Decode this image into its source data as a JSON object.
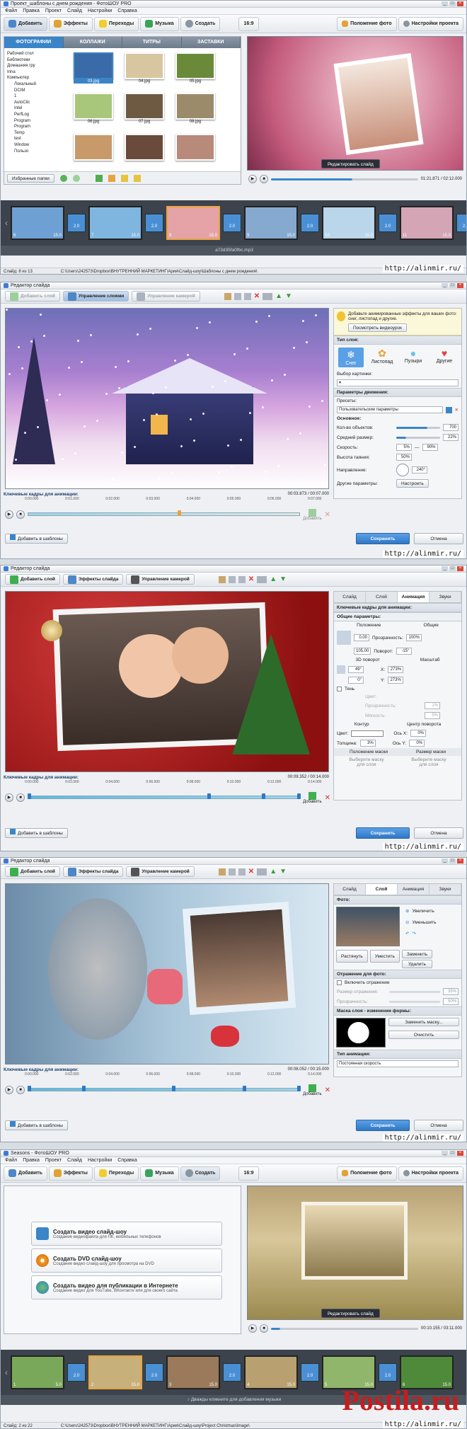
{
  "s1": {
    "title": "Проект_шаблоны с днем рождения - ФотоШОУ PRO",
    "menu": [
      "Файл",
      "Правка",
      "Проект",
      "Слайд",
      "Настройки",
      "Справка"
    ],
    "tabs": [
      "Добавить",
      "Эффекты",
      "Переходы",
      "Музыка",
      "Создать"
    ],
    "ratio": "16:9",
    "photo_pos": "Положение фото",
    "proj_settings": "Настройки проекта",
    "subtabs": [
      "ФОТОГРАФИИ",
      "КОЛЛАЖИ",
      "ТИТРЫ",
      "ЗАСТАВКИ"
    ],
    "tree": [
      "Рабочий стол",
      "Библиотеки",
      "Домашняя гру",
      "Irina",
      "Компьютер",
      "Локальный",
      "DCIM",
      "1",
      "AutoClic",
      "Intel",
      "PerfLog",
      "Program",
      "Program",
      "Temp",
      "test",
      "Window",
      "Пользо"
    ],
    "files": [
      "03.jpg",
      "04.jpg",
      "05.jpg",
      "06.jpg",
      "07.jpg",
      "08.jpg",
      "",
      "",
      ""
    ],
    "fav": "Избранные папки",
    "edit_slide": "Редактировать слайд",
    "time": "01:21.871 / 02:12.000",
    "slides": [
      {
        "n": "6",
        "d": "15.0"
      },
      {
        "n": "7",
        "d": "15.0"
      },
      {
        "n": "8",
        "d": "15.0"
      },
      {
        "n": "9",
        "d": "15.0"
      },
      {
        "n": "10",
        "d": "15.0"
      },
      {
        "n": "11",
        "d": "15.0"
      }
    ],
    "trans": [
      "2.0",
      "2.0",
      "2.0",
      "2.0",
      "2.0",
      "2.0"
    ],
    "audio": "a73d35fa0fbc.mp3",
    "status_left": "Слайд: 8 из 13",
    "status_path": "C:\\Users\\242573\\Dropbox\\ВНУТРЕННИЙ МАРКЕТИНГ\\Ария\\Слайд-шоу\\Шаблоны с днем рождения\\",
    "watermark": "http://alinmir.ru/"
  },
  "s2": {
    "title": "Редактор слайда",
    "tools": [
      "Добавить слой",
      "Управление слоями",
      "Управление камерой"
    ],
    "tip": "Добавьте анимированные эффекты для ваших фото: снег, листопад и другие.",
    "tip_btn": "Посмотреть видеоурок",
    "layer_type": "Тип слоя:",
    "types": [
      "Снег",
      "Листопад",
      "Пузыри",
      "Другие"
    ],
    "pick": "Выбор картинки:",
    "motion": "Параметры движения:",
    "presets": "Пресеты:",
    "preset_val": "Пользовательские параметры",
    "basic": "Основное:",
    "count_l": "Кол-во объектов:",
    "count_v": "700",
    "size_l": "Средний размер:",
    "size_v": "22%",
    "speed_l": "Скорость:",
    "speed_a": "5%",
    "speed_b": "90%",
    "fade_l": "Высота таяния:",
    "fade_v": "50%",
    "dir_l": "Направление:",
    "dir_v": "240°",
    "other_l": "Другие параметры:",
    "other_btn": "Настроить",
    "kf": "Ключевые кадры для анимации:",
    "kf_time": "00:03.873 / 00:07.000",
    "ruler": [
      "0:00.000",
      "0:01.000",
      "0:02.000",
      "0:03.000",
      "0:04.000",
      "0:05.000",
      "0:06.000",
      "0:07.000"
    ],
    "add": "Добавить",
    "tmpl": "Добавить в шаблоны",
    "save": "Сохранить",
    "cancel": "Отмена",
    "watermark": "http://alinmir.ru/"
  },
  "s3": {
    "title": "Редактор слайда",
    "tools": [
      "Добавить слой",
      "Эффекты слайда",
      "Управление камерой"
    ],
    "rtabs": [
      "Слайд",
      "Слой",
      "Анимация",
      "Звуки"
    ],
    "kf_title": "Ключевые кадры для анимации:",
    "common": "Общие параметры:",
    "pos": "Положение",
    "gen": "Общие",
    "x": "0,00",
    "y": "105,00",
    "opacity_l": "Прозрачность:",
    "opacity_v": "100%",
    "rot_l": "Поворот:",
    "rot_v": "-15°",
    "r3d": "3D поворот",
    "scale": "Масштаб",
    "r3a": "49°",
    "r3b": "0°",
    "sx": "273%",
    "sy": "273%",
    "shadow": "Тень",
    "color": "Цвет:",
    "opac2": "Прозрачность:",
    "opac2v": "1%",
    "blur": "Мягкость:",
    "blurv": "5%",
    "contour": "Контур",
    "center": "Центр поворота",
    "ccolor": "Цвет:",
    "thick": "Толщина:",
    "thickv": "3%",
    "ox": "Ось X:",
    "oxv": "0%",
    "oy": "Ось Y:",
    "oyv": "0%",
    "mask1": "Положение маски",
    "mask2": "Размер маски",
    "mask_btn": "Выберите маску для слоя",
    "kf": "Ключевые кадры для анимации:",
    "kf_time": "00:09.352 / 00:14.000",
    "ruler": [
      "0:00.000",
      "0:02.000",
      "0:04.000",
      "0:06.000",
      "0:08.000",
      "0:10.000",
      "0:12.000",
      "0:14.000"
    ],
    "add": "Добавить",
    "tmpl": "Добавить в шаблоны",
    "save": "Сохранить",
    "cancel": "Отмена",
    "watermark": "http://alinmir.ru/"
  },
  "s4": {
    "title": "Редактор слайда",
    "tools": [
      "Добавить слой",
      "Эффекты слайда",
      "Управление камерой"
    ],
    "rtabs": [
      "Слайд",
      "Слой",
      "Анимация",
      "Звуки"
    ],
    "photo": "Фото:",
    "zin": "Увеличить",
    "zout": "Уменьшить",
    "stretch": "Растянуть",
    "fit": "Уместить",
    "replace": "Заменить",
    "del": "Удалить",
    "refl": "Отражение для фото:",
    "refl_on": "Включить отражение",
    "refl_size": "Размер отражения:",
    "refl_size_v": "35%",
    "refl_op": "Прозрачность:",
    "refl_op_v": "50%",
    "mask": "Маска слоя - изменение формы:",
    "mask_rep": "Заменить маску...",
    "mask_clr": "Очистить",
    "anim": "Тип анимации:",
    "anim_v": "Постоянная скорость",
    "kf": "Ключевые кадры для анимации:",
    "kf_time": "00:08.052 / 00:15.000",
    "ruler": [
      "0:00.000",
      "0:02.000",
      "0:04.000",
      "0:06.000",
      "0:08.000",
      "0:10.000",
      "0:12.000",
      "0:14.000"
    ],
    "add": "Добавить",
    "tmpl": "Добавить в шаблоны",
    "save": "Сохранить",
    "cancel": "Отмена",
    "watermark": "http://alinmir.ru/"
  },
  "s5": {
    "title": "Seasons - ФотоШОУ PRO",
    "menu": [
      "Файл",
      "Правка",
      "Проект",
      "Слайд",
      "Настройки",
      "Справка"
    ],
    "tabs": [
      "Добавить",
      "Эффекты",
      "Переходы",
      "Музыка",
      "Создать"
    ],
    "ratio": "16:9",
    "photo_pos": "Положение фото",
    "proj_settings": "Настройки проекта",
    "opts": [
      {
        "t": "Создать видео слайд-шоу",
        "d": "Создание видеофайла для ПК, мобильных телефонов"
      },
      {
        "t": "Создать DVD слайд-шоу",
        "d": "Создание видео слайд-шоу для просмотра на DVD"
      },
      {
        "t": "Создать видео для публикации в Интернете",
        "d": "Создание видео для YouTube, ВКонтакте или для своего сайта"
      }
    ],
    "edit_slide": "Редактировать слайд",
    "time": "00:10.155 / 03:11.000",
    "slides": [
      {
        "n": "1",
        "d": "5.0"
      },
      {
        "n": "2",
        "d": "15.0"
      },
      {
        "n": "3",
        "d": "15.0"
      },
      {
        "n": "4",
        "d": "15.0"
      },
      {
        "n": "5",
        "d": "15.0"
      },
      {
        "n": "6",
        "d": "15.0"
      }
    ],
    "trans": [
      "2.0",
      "2.0",
      "2.0",
      "2.0",
      "2.0"
    ],
    "audio": "Дважды кликните для добавления музыки",
    "status_left": "Слайд: 2 из 22",
    "status_path": "C:\\Users\\242573\\Dropbox\\ВНУТРЕННИЙ МАРКЕТИНГ\\Ария\\Слайд-шоу\\Project Christmas\\image\\",
    "brand": "Postila.ru",
    "watermark": "http://alinmir.ru/"
  },
  "colors": {
    "accent": "#3a85c8",
    "save": "#2f78c5",
    "timeline": "#3c434c"
  },
  "icons": [
    "add-icon",
    "effects-icon",
    "transitions-icon",
    "music-icon",
    "create-icon",
    "snow-icon",
    "leaf-icon",
    "bubbles-icon",
    "other-icon",
    "play-icon",
    "stop-icon"
  ]
}
